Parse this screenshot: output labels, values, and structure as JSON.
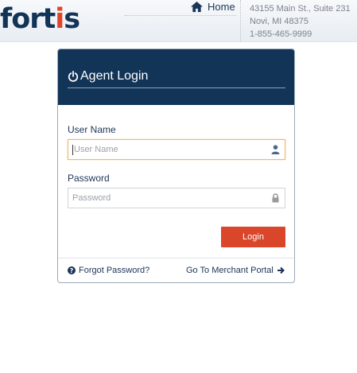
{
  "header": {
    "logo_main": "fort",
    "logo_accent": "i",
    "logo_tail": "s",
    "home_label": "Home",
    "address_line1": "43155 Main St., Suite 231",
    "address_line2": "Novi, MI 48375",
    "phone": "1-855-465-9999"
  },
  "login": {
    "title": "Agent Login",
    "username_label": "User Name",
    "username_placeholder": "User Name",
    "password_label": "Password",
    "password_placeholder": "Password",
    "submit_label": "Login",
    "forgot_label": "Forgot Password?",
    "merchant_portal_label": "Go To Merchant Portal"
  },
  "colors": {
    "brand_navy": "#123457",
    "brand_accent": "#e0452a",
    "button_red": "#d9462a"
  },
  "icons": {
    "home": "home-icon",
    "power": "power-icon",
    "user": "user-icon",
    "lock": "lock-icon",
    "question": "question-circle-icon",
    "arrow": "arrow-right-icon"
  }
}
